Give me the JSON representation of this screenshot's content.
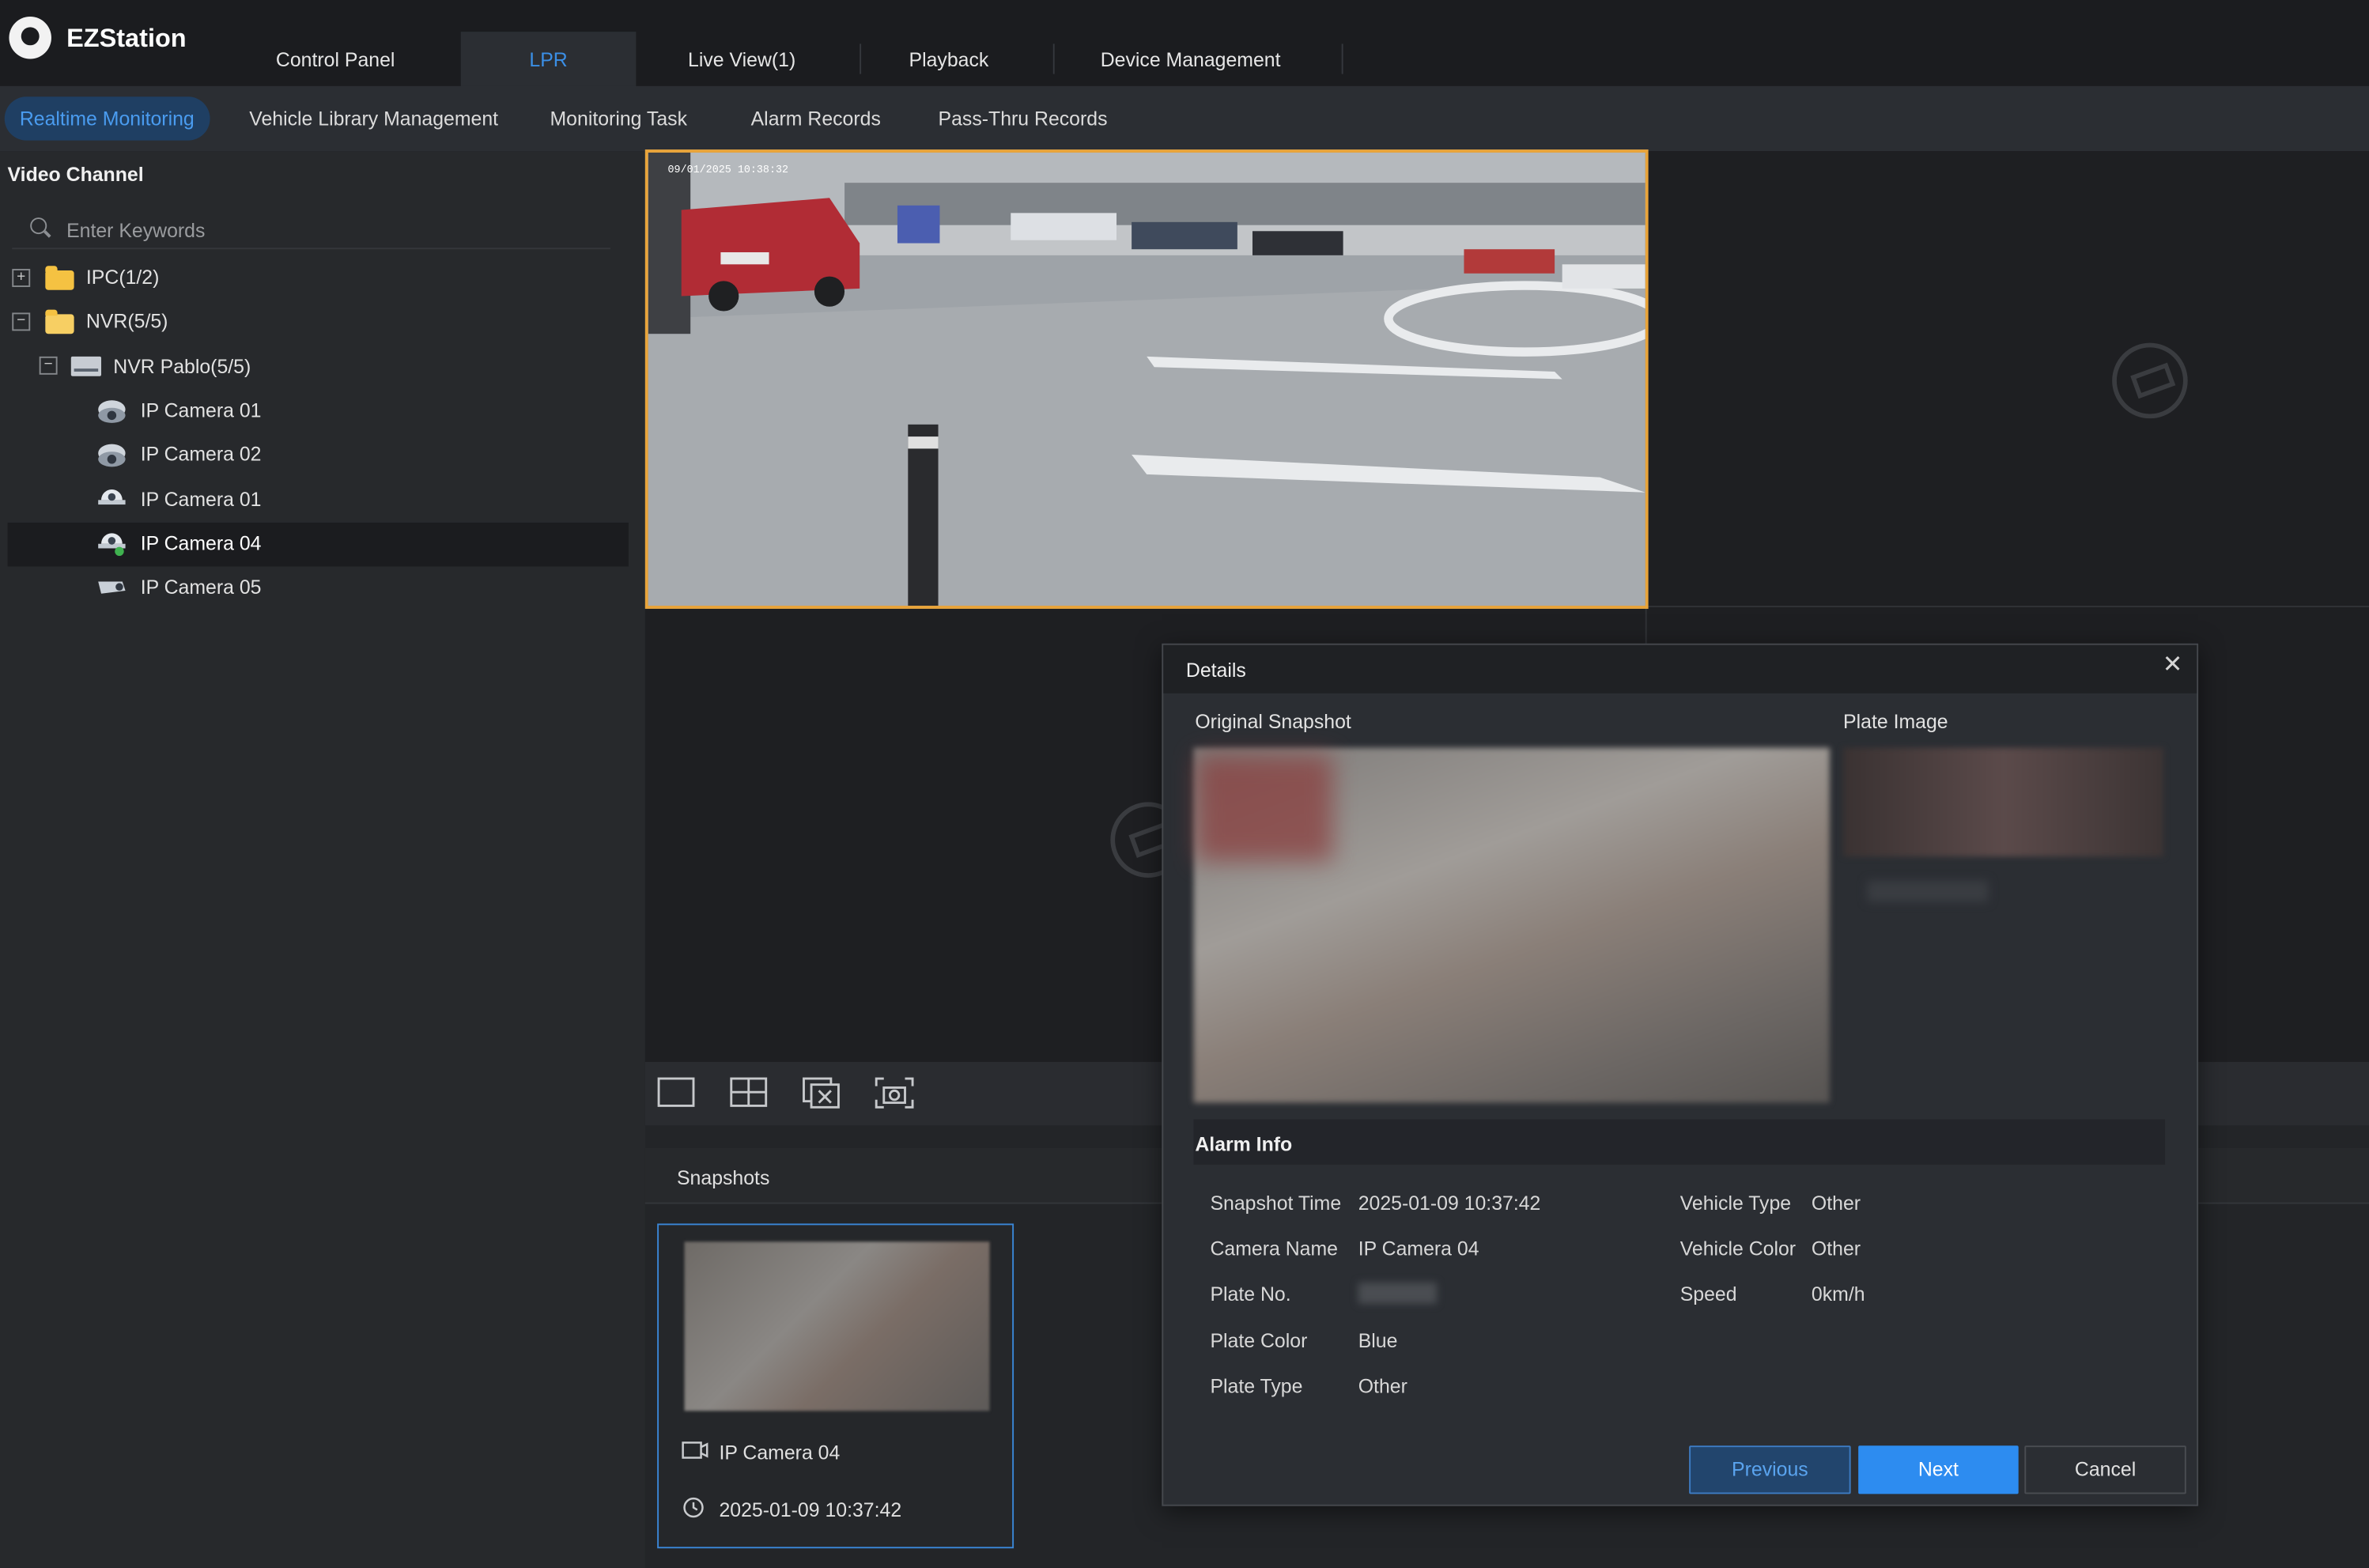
{
  "app": {
    "name": "EZStation"
  },
  "main_tabs": [
    {
      "label": "Control Panel",
      "active": false
    },
    {
      "label": "LPR",
      "active": true
    },
    {
      "label": "Live View(1)",
      "active": false
    },
    {
      "label": "Playback",
      "active": false
    },
    {
      "label": "Device Management",
      "active": false
    }
  ],
  "sub_tabs": [
    {
      "label": "Realtime Monitoring",
      "active": true
    },
    {
      "label": "Vehicle Library Management",
      "active": false
    },
    {
      "label": "Monitoring Task",
      "active": false
    },
    {
      "label": "Alarm Records",
      "active": false
    },
    {
      "label": "Pass-Thru Records",
      "active": false
    }
  ],
  "sidebar": {
    "title": "Video Channel",
    "search_placeholder": "Enter Keywords",
    "tree": [
      {
        "label": "IPC(1/2)",
        "toggle": "+",
        "icon": "folder-icon"
      },
      {
        "label": "NVR(5/5)",
        "toggle": "−",
        "icon": "folder-open-icon"
      },
      {
        "label": "NVR Pablo(5/5)",
        "toggle": "−",
        "icon": "nvr-icon"
      },
      {
        "label": "IP Camera 01",
        "icon": "fisheye-camera-icon"
      },
      {
        "label": "IP Camera 02",
        "icon": "fisheye-camera-icon"
      },
      {
        "label": "IP Camera 01",
        "icon": "dome-camera-icon"
      },
      {
        "label": "IP Camera 04",
        "icon": "dome-camera-icon",
        "selected": true
      },
      {
        "label": "IP Camera 05",
        "icon": "bullet-camera-icon"
      }
    ]
  },
  "video": {
    "timestamp": "09/01/2025 10:38:32",
    "toolbar_icons": [
      "single-window-icon",
      "four-window-icon",
      "close-all-icon",
      "snapshot-icon"
    ]
  },
  "snapshots": {
    "title": "Snapshots",
    "items": [
      {
        "camera": "IP Camera 04",
        "time": "2025-01-09 10:37:42"
      }
    ]
  },
  "details": {
    "title": "Details",
    "original_snapshot_label": "Original Snapshot",
    "plate_image_label": "Plate Image",
    "alarm_info_title": "Alarm Info",
    "fields_left": [
      {
        "key": "Snapshot Time",
        "value": "2025-01-09 10:37:42"
      },
      {
        "key": "Camera Name",
        "value": "IP Camera 04"
      },
      {
        "key": "Plate No.",
        "value": "",
        "redacted": true
      },
      {
        "key": "Plate Color",
        "value": "Blue"
      },
      {
        "key": "Plate Type",
        "value": "Other"
      }
    ],
    "fields_right": [
      {
        "key": "Vehicle Type",
        "value": "Other"
      },
      {
        "key": "Vehicle Color",
        "value": "Other"
      },
      {
        "key": "Speed",
        "value": "0km/h"
      }
    ],
    "buttons": {
      "previous": "Previous",
      "next": "Next",
      "cancel": "Cancel"
    }
  },
  "colors": {
    "accent": "#2d8cf0",
    "active_tab_text": "#3b8fe6",
    "selected_border": "#e9a43a",
    "folder": "#f5c242"
  }
}
